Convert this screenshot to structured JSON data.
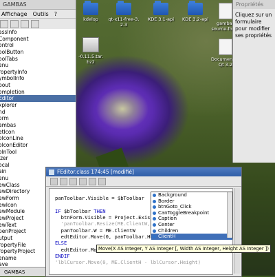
{
  "project_window": {
    "title": "GAMBAS",
    "menu": [
      "Affichage",
      "Outils",
      "?"
    ],
    "items": [
      "assInfo",
      "Component",
      "ontrol",
      "oolButton",
      "oolTabs",
      "enu",
      "ropertyInfo",
      "ymbolInfo",
      "bout",
      "ompletion",
      "Editor",
      "xplorer",
      "nd",
      "orm",
      "ambas",
      "etIcon",
      "oIconLine",
      "oIconEditor",
      "oInTool",
      "izer",
      "ocal",
      "ain",
      "enu",
      "ewClass",
      "ewDirectory",
      "ewForm",
      "ewIcon",
      "ewModule",
      "ewProject",
      "ewText",
      "penProject",
      "utput",
      "ropertyFile",
      "ropertyProject",
      "ename",
      "ave"
    ],
    "selected_index": 10,
    "status": "GAMBAS"
  },
  "desktop_icons": [
    {
      "label_lines": [
        "kdelop"
      ],
      "type": "folder"
    },
    {
      "label_lines": [
        "qt-x11-free-3.",
        "2.3"
      ],
      "type": "folder"
    },
    {
      "label_lines": [
        "KDE 3.1-api"
      ],
      "type": "folder"
    },
    {
      "label_lines": [
        "KDE 3.2-api"
      ],
      "type": "folder"
    },
    {
      "label_lines": [
        "gambas",
        "source-forge"
      ],
      "type": "file"
    },
    {
      "label_lines": [
        "-0.11.5.tar.",
        "bz2"
      ],
      "type": "package"
    },
    {
      "label_lines": [
        "Documentati",
        "Qt 3.2"
      ],
      "type": "file"
    }
  ],
  "properties_window": {
    "title": "Propriétés",
    "body": "Cliquez sur un formulaire pour modifier ses propriétés"
  },
  "editor": {
    "title": "FEditor.class 174:45 [modifié]",
    "lines": [
      [
        {
          "t": "",
          "c": ""
        }
      ],
      [
        {
          "t": "panToolbar.Visible = $bToolbar",
          "c": ""
        }
      ],
      [
        {
          "t": "",
          "c": ""
        }
      ],
      [
        {
          "t": "IF ",
          "c": "kw"
        },
        {
          "t": "$bToolbar ",
          "c": ""
        },
        {
          "t": "THEN",
          "c": "kw"
        }
      ],
      [
        {
          "t": "  btnForm.Visible = Project.ExistForm(",
          "c": ""
        }
      ],
      [
        {
          "t": "  'panToolbar.Resize(ME.ClientW, btnGo",
          "c": "cm"
        }
      ],
      [
        {
          "t": "  panToolbar.W = ME.ClientW",
          "c": ""
        }
      ],
      [
        {
          "t": "  edtEditor.Move(0, panToolbar.H, ME.C",
          "c": ""
        },
        {
          "t": "oolbar.H",
          "c": ""
        }
      ],
      [
        {
          "t": "ELSE",
          "c": "kw"
        }
      ],
      [
        {
          "t": "  edtEditor.Move(0, 0, ME.ClientW, ME.Cli",
          "c": ""
        }
      ],
      [
        {
          "t": "ENDIF",
          "c": "kw"
        }
      ],
      [
        {
          "t": "'lblCursor.Move(0, ME.ClientH - lblCursor.Height)",
          "c": "cm"
        }
      ]
    ],
    "autocomplete": [
      "Background",
      "Border",
      "btnGoto_Click",
      "CanToggleBreakpoint",
      "Caption",
      "Center",
      "Children",
      "ClientH"
    ],
    "autocomplete_selected": 7,
    "tooltip": "Move(X AS Integer, Y AS Integer [, Width AS Integer, Height AS Integer ])"
  }
}
